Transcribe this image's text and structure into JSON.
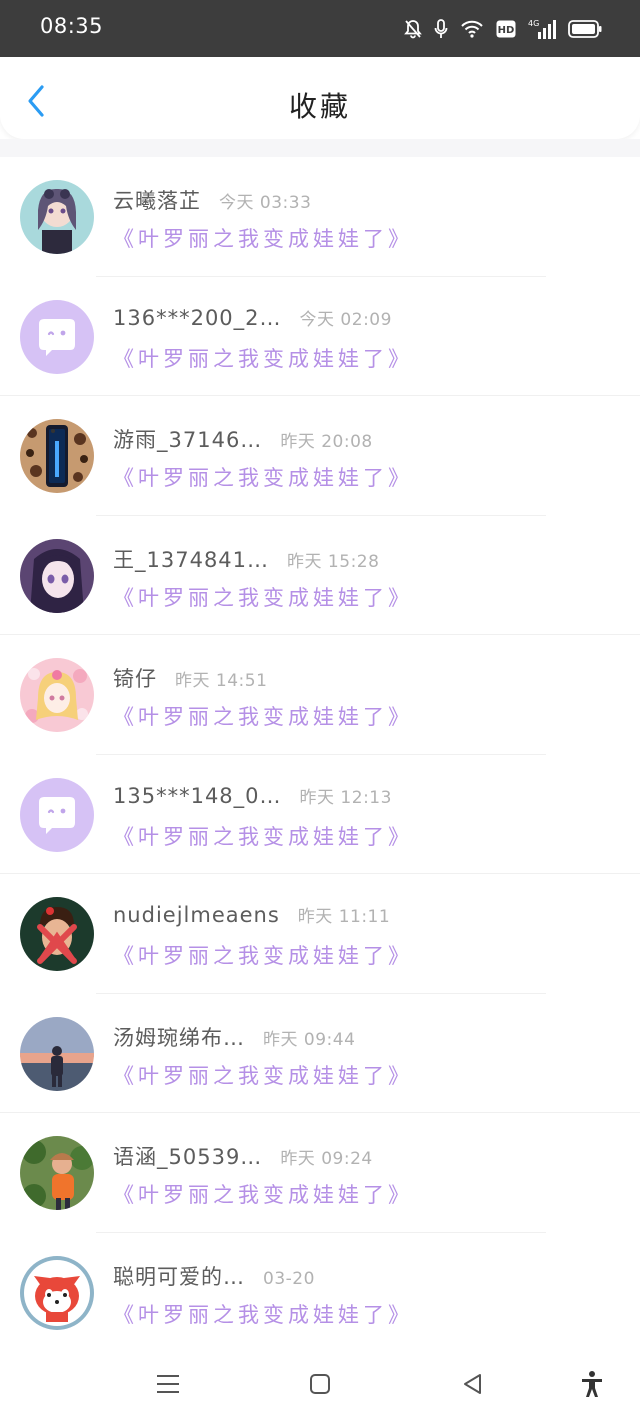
{
  "status_bar": {
    "time": "08:35",
    "icons": [
      "bell-off-icon",
      "microphone-icon",
      "wifi-icon",
      "hd-icon",
      "signal-4g-icon",
      "battery-icon"
    ],
    "hd_label": "HD",
    "network_label": "4G"
  },
  "header": {
    "title": "收藏",
    "back_icon": "chevron-left-icon",
    "accent_color": "#2b9cf3"
  },
  "items": [
    {
      "name": "云曦落芷",
      "time": "今天 03:33",
      "title": "《叶罗丽之我变成娃娃了》",
      "avatar": "anime-girl-avatar"
    },
    {
      "name": "136***200_2…",
      "time": "今天 02:09",
      "title": "《叶罗丽之我变成娃娃了》",
      "avatar": "default-chat-avatar"
    },
    {
      "name": "游雨_37146…",
      "time": "昨天 20:08",
      "title": "《叶罗丽之我变成娃娃了》",
      "avatar": "phone-leopard-avatar"
    },
    {
      "name": "王_1374841…",
      "time": "昨天 15:28",
      "title": "《叶罗丽之我变成娃娃了》",
      "avatar": "purple-anime-avatar"
    },
    {
      "name": "锜仔",
      "time": "昨天 14:51",
      "title": "《叶罗丽之我变成娃娃了》",
      "avatar": "pink-anime-avatar"
    },
    {
      "name": "135***148_0…",
      "time": "昨天 12:13",
      "title": "《叶罗丽之我变成娃娃了》",
      "avatar": "default-chat-avatar"
    },
    {
      "name": "nudiejlmeaens",
      "time": "昨天 11:11",
      "title": "《叶罗丽之我变成娃娃了》",
      "avatar": "cross-face-avatar"
    },
    {
      "name": "汤姆琬绨布…",
      "time": "昨天 09:44",
      "title": "《叶罗丽之我变成娃娃了》",
      "avatar": "sunset-person-avatar"
    },
    {
      "name": "语涵_50539…",
      "time": "昨天 09:24",
      "title": "《叶罗丽之我变成娃娃了》",
      "avatar": "outdoor-child-avatar"
    },
    {
      "name": "聪明可爱的…",
      "time": "03-20",
      "title": "《叶罗丽之我变成娃娃了》",
      "avatar": "cartoon-fox-avatar"
    }
  ],
  "nav_bar": {
    "buttons": [
      "menu-icon",
      "home-square-icon",
      "back-triangle-icon",
      "accessibility-icon"
    ]
  },
  "colors": {
    "title_link": "#b590e6",
    "status_bar_bg": "#3d3d3d",
    "default_avatar_bg": "#d6c2f5"
  }
}
